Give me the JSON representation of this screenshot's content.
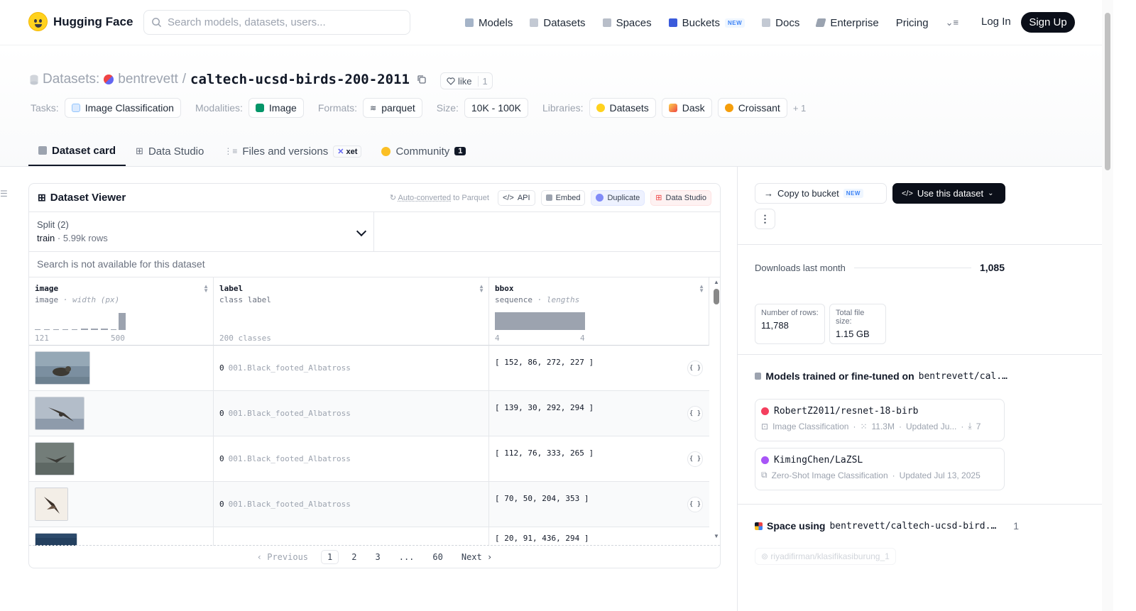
{
  "nav": {
    "brand": "Hugging Face",
    "search_placeholder": "Search models, datasets, users...",
    "links": [
      "Models",
      "Datasets",
      "Spaces",
      "Buckets",
      "Docs",
      "Enterprise",
      "Pricing"
    ],
    "new_badge": "NEW",
    "login": "Log In",
    "signup": "Sign Up"
  },
  "header": {
    "section_label": "Datasets:",
    "owner": "bentrevett",
    "separator": "/",
    "repo": "caltech-ucsd-birds-200-2011",
    "like_label": "like",
    "like_count": "1",
    "tasks_label": "Tasks:",
    "task": "Image Classification",
    "modalities_label": "Modalities:",
    "modality": "Image",
    "formats_label": "Formats:",
    "format": "parquet",
    "size_label": "Size:",
    "size": "10K - 100K",
    "libraries_label": "Libraries:",
    "libraries": [
      "Datasets",
      "Dask",
      "Croissant"
    ],
    "more_libraries": "+ 1"
  },
  "tabs": {
    "card": "Dataset card",
    "studio": "Data Studio",
    "files": "Files and versions",
    "xet": "xet",
    "community": "Community",
    "community_count": "1"
  },
  "viewer": {
    "title": "Dataset Viewer",
    "auto_converted": "Auto-converted",
    "to_parquet": "to Parquet",
    "api": "API",
    "embed": "Embed",
    "duplicate": "Duplicate",
    "data_studio": "Data Studio",
    "split_label": "Split (2)",
    "split_value": "train",
    "split_rows": "· 5.99k rows",
    "search_na": "Search is not available for this dataset",
    "columns": [
      {
        "name": "image",
        "type": "image",
        "sub": "· width (px)",
        "min": "121",
        "max": "500"
      },
      {
        "name": "label",
        "type": "class label",
        "sub": "",
        "foot": "200 classes"
      },
      {
        "name": "bbox",
        "type": "sequence",
        "sub": "· lengths",
        "min": "4",
        "max": "4"
      }
    ],
    "rows": [
      {
        "label_id": "0",
        "label_name": "001.Black_footed_Albatross",
        "bbox": "[ 152, 86, 272, 227 ]"
      },
      {
        "label_id": "0",
        "label_name": "001.Black_footed_Albatross",
        "bbox": "[ 139, 30, 292, 294 ]"
      },
      {
        "label_id": "0",
        "label_name": "001.Black_footed_Albatross",
        "bbox": "[ 112, 76, 333, 265 ]"
      },
      {
        "label_id": "0",
        "label_name": "001.Black_footed_Albatross",
        "bbox": "[ 70, 50, 204, 353 ]"
      },
      {
        "label_id": "",
        "label_name": "",
        "bbox": "[ 20, 91, 436, 294 ]"
      }
    ],
    "json_icon": "{ }",
    "pager": {
      "previous": "Previous",
      "pages": [
        "1",
        "2",
        "3",
        "...",
        "60"
      ],
      "next": "Next"
    }
  },
  "sidebar": {
    "copy_bucket": "Copy to bucket",
    "new_badge": "NEW",
    "use_dataset": "Use this dataset",
    "downloads_label": "Downloads last month",
    "downloads": "1,085",
    "rows_label": "Number of rows:",
    "rows_value": "11,788",
    "filesize_label": "Total file size:",
    "filesize_value": "1.15 GB",
    "models_title": "Models trained or fine-tuned on",
    "models_repo": "bentrevett/cal...",
    "models": [
      {
        "name": "RobertZ2011/resnet-18-birb",
        "task": "Image Classification",
        "params": "11.3M",
        "updated": "Updated Ju...",
        "downloads": "7",
        "color": "#f43f5e"
      },
      {
        "name": "KimingChen/LaZSL",
        "task": "Zero-Shot Image Classification",
        "updated": "Updated Jul 13, 2025",
        "color": "#a855f7"
      }
    ],
    "space_title": "Space using",
    "space_repo": "bentrevett/caltech-ucsd-bird...",
    "space_count": "1",
    "space": "riyadifirman/klasifikasiburung_1"
  }
}
